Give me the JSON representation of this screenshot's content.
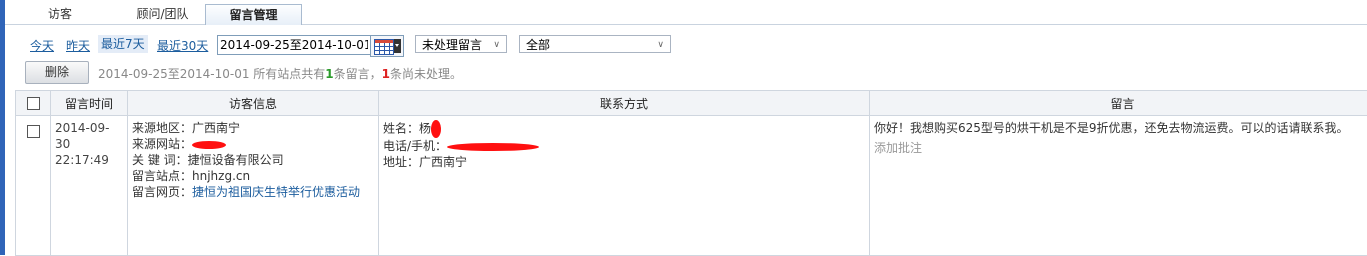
{
  "tabs": [
    "访客",
    "顾问/团队",
    "留言管理"
  ],
  "date_links": [
    "今天",
    "昨天",
    "最近7天",
    "最近30天"
  ],
  "date_range": "2014-09-25至2014-10-01",
  "status_filter": "未处理留言",
  "site_filter": "全部",
  "delete_label": "删除",
  "summary": {
    "pre": "2014-09-25至2014-10-01  所有站点共有",
    "total": "1",
    "mid": "条留言，",
    "pending": "1",
    "post": "条尚未处理。"
  },
  "columns": [
    "留言时间",
    "访客信息",
    "联系方式",
    "留言"
  ],
  "row": {
    "date": "2014-09-30",
    "time": "22:17:49",
    "visitor": {
      "region": "来源地区：广西南宁",
      "site_label": "来源网站：",
      "keyword": "关 键 词：捷恒设备有限公司",
      "station": "留言站点：hnjhzg.cn",
      "page_label": "留言网页：",
      "page_link": "捷恒为祖国庆生特举行优惠活动"
    },
    "contact": {
      "name_label": "姓名：杨",
      "phone_label": "电话/手机：",
      "address": "地址：广西南宁"
    },
    "message": "你好！我想购买625型号的烘干机是不是9折优惠，还免去物流运费。可以的话请联系我。",
    "add_note": "添加批注"
  },
  "colors": {
    "accent_link": "#1c5d9e",
    "count_green": "#2a9a2a",
    "count_red": "#d22222",
    "left_bar": "#2f64b8"
  }
}
